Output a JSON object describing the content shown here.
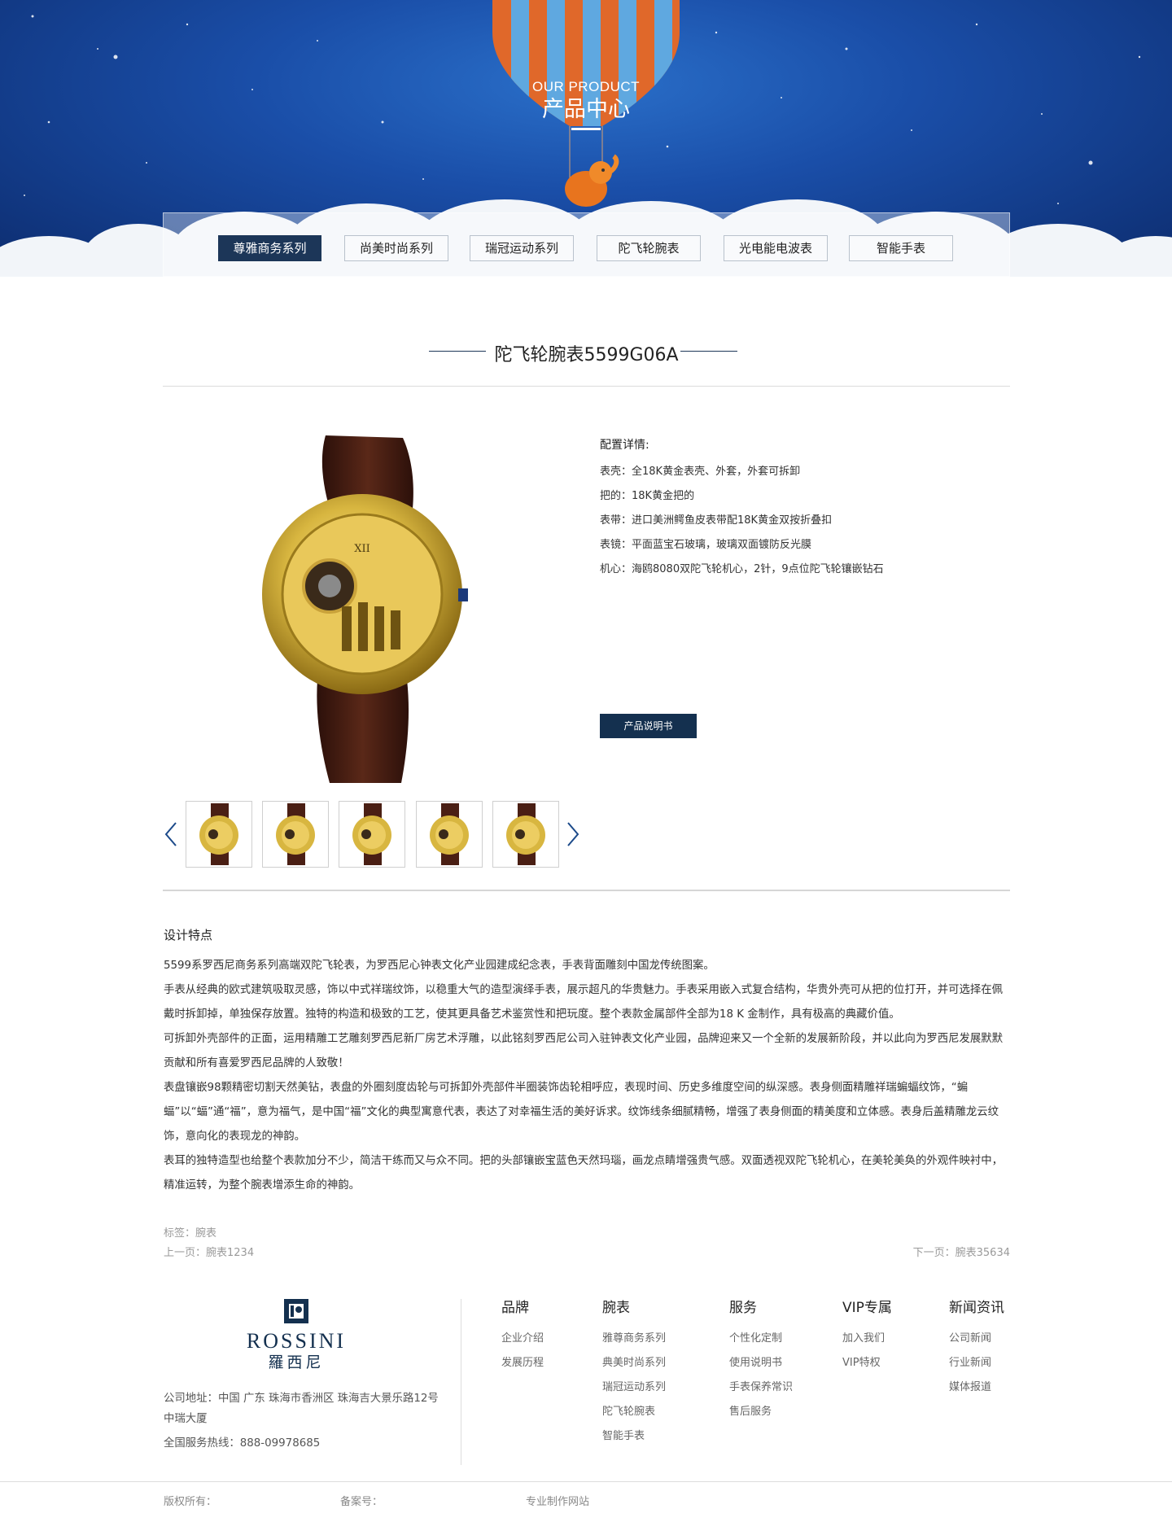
{
  "banner": {
    "title_en": "OUR PRODUCT",
    "title_cn": "产品中心"
  },
  "tabs": [
    {
      "label": "尊雅商务系列",
      "active": true
    },
    {
      "label": "尚美时尚系列",
      "active": false
    },
    {
      "label": "瑞冠运动系列",
      "active": false
    },
    {
      "label": "陀飞轮腕表",
      "active": false
    },
    {
      "label": "光电能电波表",
      "active": false
    },
    {
      "label": "智能手表",
      "active": false
    }
  ],
  "product": {
    "title": "陀飞轮腕表5599G06A",
    "spec_title": "配置详情:",
    "specs": [
      "表壳：全18K黄金表壳、外套，外套可拆卸",
      "把的：18K黄金把的",
      "表带：进口美洲鳄鱼皮表带配18K黄金双按折叠扣",
      "表镜：平面蓝宝石玻璃，玻璃双面镀防反光膜",
      "机心：海鸥8080双陀飞轮机心，2针，9点位陀飞轮镶嵌钻石"
    ],
    "manual_button": "产品说明书"
  },
  "design": {
    "title": "设计特点",
    "paragraphs": [
      "5599系罗西尼商务系列高端双陀飞轮表，为罗西尼心钟表文化产业园建成纪念表，手表背面雕刻中国龙传统图案。",
      "手表从经典的欧式建筑吸取灵感，饰以中式祥瑞纹饰，以稳重大气的造型演绎手表，展示超凡的华贵魅力。手表采用嵌入式复合结构，华贵外壳可从把的位打开，并可选择在佩戴时拆卸掉，单独保存放置。独特的构造和极致的工艺，使其更具备艺术鉴赏性和把玩度。整个表款金属部件全部为18 K 金制作，具有极高的典藏价值。",
      "可拆卸外壳部件的正面，运用精雕工艺雕刻罗西尼新厂房艺术浮雕，以此铭刻罗西尼公司入驻钟表文化产业园，品牌迎来又一个全新的发展新阶段，并以此向为罗西尼发展默默贡献和所有喜爱罗西尼品牌的人致敬！",
      "表盘镶嵌98颗精密切割天然美钻，表盘的外圈刻度齿轮与可拆卸外壳部件半圈装饰齿轮相呼应，表现时间、历史多维度空间的纵深感。表身侧面精雕祥瑞蝙蝠纹饰，“蝙蝠”以“蝠”通“福”，意为福气，是中国“福”文化的典型寓意代表，表达了对幸福生活的美好诉求。纹饰线条细腻精畅，增强了表身侧面的精美度和立体感。表身后盖精雕龙云纹饰，意向化的表现龙的神韵。",
      "表耳的独特造型也给整个表款加分不少，简洁干练而又与众不同。把的头部镶嵌宝蓝色天然玛瑙，画龙点睛增强贵气感。双面透视双陀飞轮机心，在美轮美奂的外观件映衬中，精准运转，为整个腕表增添生命的神韵。"
    ]
  },
  "meta": {
    "tags": "标签：腕表",
    "prev": "上一页：腕表1234",
    "next": "下一页：腕表35634"
  },
  "footer": {
    "logo_text": "ROSSINI",
    "logo_cn": "羅西尼",
    "address": "公司地址：中国 广东 珠海市香洲区 珠海吉大景乐路12号中瑞大厦",
    "hotline": "全国服务热线：888-09978685",
    "columns": [
      {
        "title": "品牌",
        "links": [
          "企业介绍",
          "发展历程"
        ]
      },
      {
        "title": "腕表",
        "links": [
          "雅尊商务系列",
          "典美时尚系列",
          "瑞冠运动系列",
          "陀飞轮腕表",
          "智能手表"
        ]
      },
      {
        "title": "服务",
        "links": [
          "个性化定制",
          "使用说明书",
          "手表保养常识",
          "售后服务"
        ]
      },
      {
        "title": "VIP专属",
        "links": [
          "加入我们",
          "VIP特权"
        ]
      },
      {
        "title": "新闻资讯",
        "links": [
          "公司新闻",
          "行业新闻",
          "媒体报道"
        ]
      }
    ],
    "copyright": "版权所有：",
    "icp": "备案号：",
    "maker": "专业制作网站"
  },
  "colors": {
    "navy": "#14304f",
    "banner_blue": "#1a4ea8",
    "gold": "#d8b640",
    "strap_brown": "#4a1f14"
  }
}
